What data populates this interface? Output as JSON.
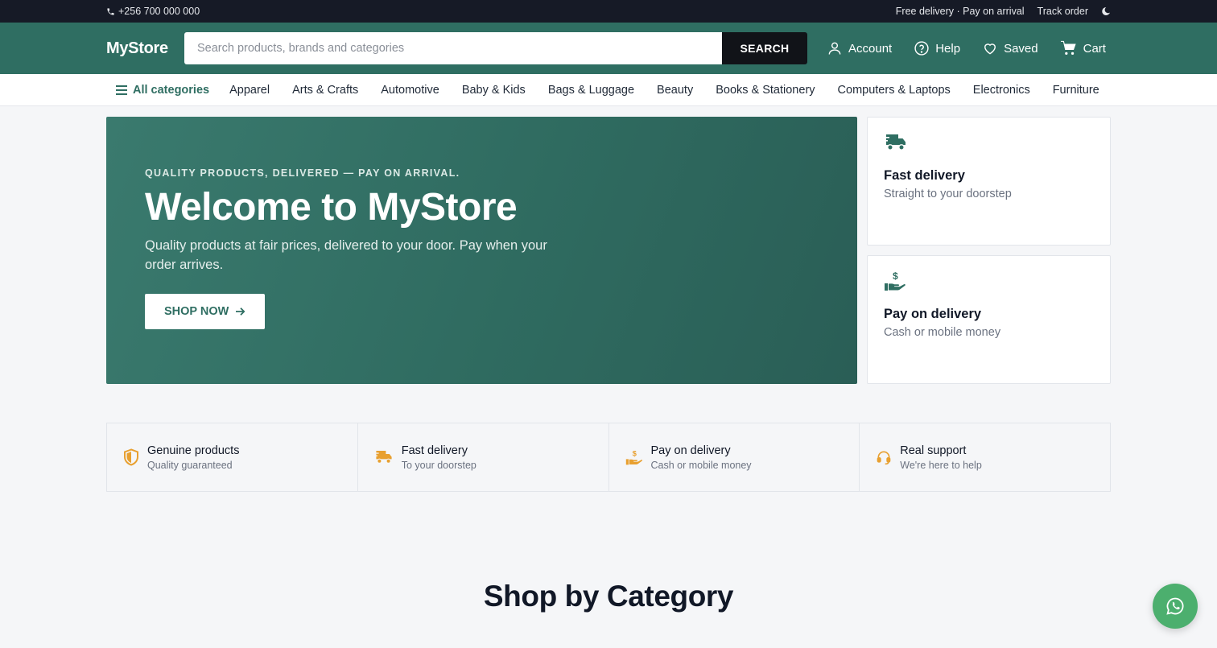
{
  "topbar": {
    "phone": "+256 700 000 000",
    "promo": "Free delivery · Pay on arrival",
    "track_order": "Track order"
  },
  "header": {
    "logo": "MyStore",
    "search_placeholder": "Search products, brands and categories",
    "search_button": "SEARCH",
    "nav": {
      "account": "Account",
      "help": "Help",
      "saved": "Saved",
      "cart": "Cart"
    }
  },
  "categories": {
    "all_label": "All categories",
    "items": [
      "Apparel",
      "Arts & Crafts",
      "Automotive",
      "Baby & Kids",
      "Bags & Luggage",
      "Beauty",
      "Books & Stationery",
      "Computers & Laptops",
      "Electronics",
      "Furniture"
    ]
  },
  "hero": {
    "eyebrow": "QUALITY PRODUCTS, DELIVERED — PAY ON ARRIVAL.",
    "title": "Welcome to MyStore",
    "subtitle": "Quality products at fair prices, delivered to your door. Pay when your order arrives.",
    "cta": "SHOP NOW"
  },
  "side_cards": [
    {
      "title": "Fast delivery",
      "subtitle": "Straight to your doorstep",
      "icon": "truck-icon"
    },
    {
      "title": "Pay on delivery",
      "subtitle": "Cash or mobile money",
      "icon": "hand-money-icon"
    }
  ],
  "features": [
    {
      "title": "Genuine products",
      "subtitle": "Quality guaranteed",
      "icon": "shield-icon"
    },
    {
      "title": "Fast delivery",
      "subtitle": "To your doorstep",
      "icon": "truck-icon"
    },
    {
      "title": "Pay on delivery",
      "subtitle": "Cash or mobile money",
      "icon": "hand-money-icon"
    },
    {
      "title": "Real support",
      "subtitle": "We're here to help",
      "icon": "headset-icon"
    }
  ],
  "section": {
    "title": "Shop by Category"
  },
  "colors": {
    "brand": "#2f6e62",
    "accent": "#e8a030",
    "topbar": "#161a26",
    "whatsapp": "#4caf6e"
  }
}
